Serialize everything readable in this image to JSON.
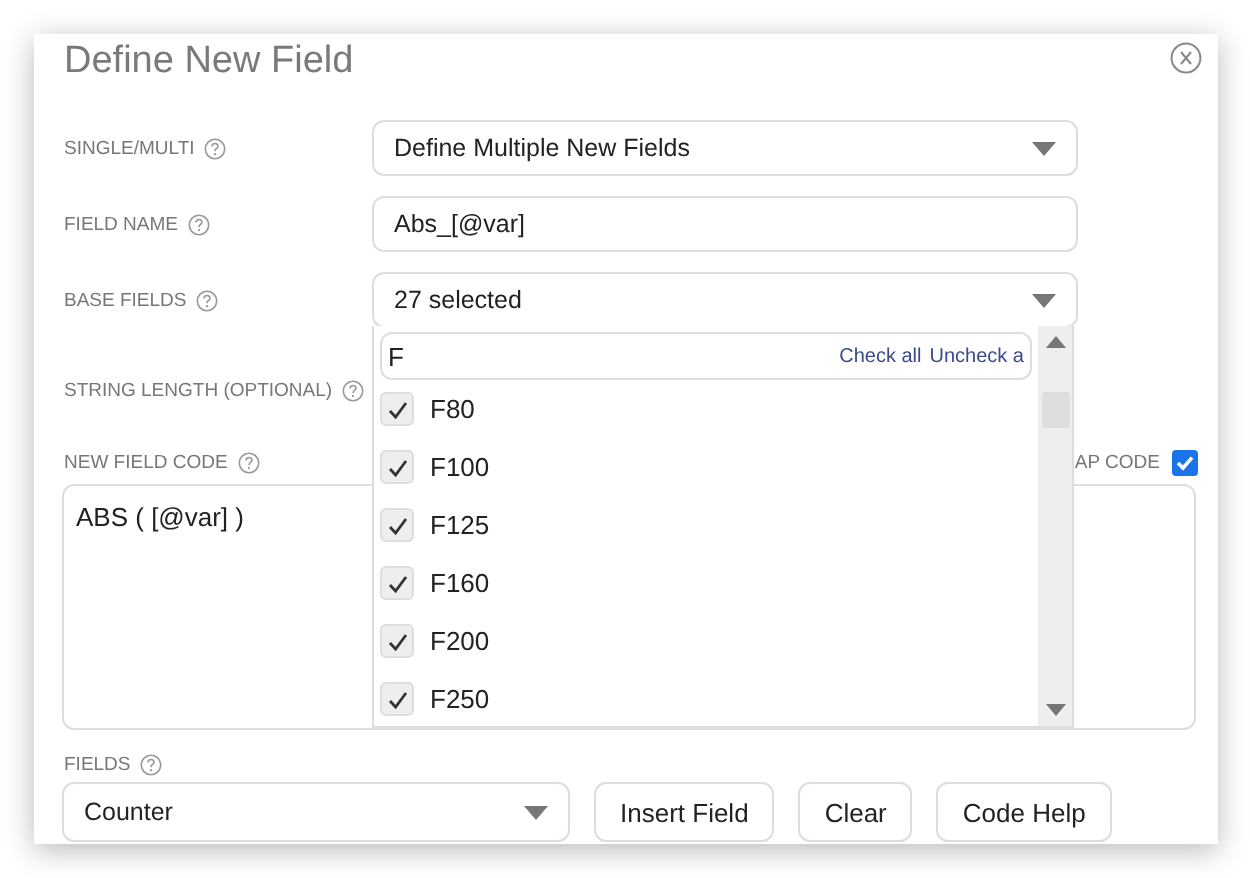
{
  "dialog": {
    "title": "Define New Field"
  },
  "rows": [
    {
      "kind": "select",
      "label": "SINGLE/MULTI",
      "value": "Define Multiple New Fields"
    },
    {
      "kind": "text",
      "label": "FIELD NAME",
      "value": "Abs_[@var]"
    },
    {
      "kind": "select",
      "label": "BASE FIELDS",
      "value": "27 selected"
    },
    {
      "kind": "covered",
      "label": "STRING LENGTH (OPTIONAL)"
    }
  ],
  "code": {
    "label": "NEW FIELD CODE",
    "wrap_label": "AP CODE",
    "wrap_checked": true,
    "value": "ABS ( [@var] )"
  },
  "dropdown": {
    "search_value": "F",
    "links": [
      "Check all",
      "Uncheck a"
    ],
    "items": [
      {
        "label": "F80",
        "checked": true
      },
      {
        "label": "F100",
        "checked": true
      },
      {
        "label": "F125",
        "checked": true
      },
      {
        "label": "F160",
        "checked": true
      },
      {
        "label": "F200",
        "checked": true
      },
      {
        "label": "F250",
        "checked": true
      }
    ]
  },
  "fields": {
    "label": "FIELDS",
    "value": "Counter"
  },
  "buttons": [
    "Insert Field",
    "Clear",
    "Code Help"
  ]
}
